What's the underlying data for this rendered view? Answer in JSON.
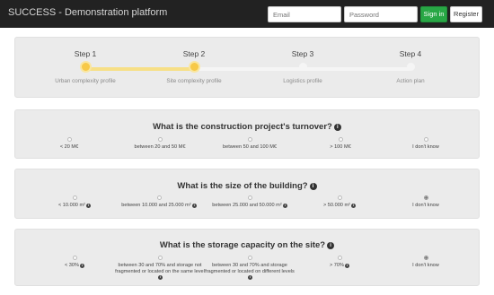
{
  "app": {
    "brand": "SUCCESS - Demonstration platform"
  },
  "nav": {
    "email_placeholder": "Email",
    "password_placeholder": "Password",
    "signin_label": "Sign in",
    "register_label": "Register"
  },
  "steps": [
    {
      "title": "Step 1",
      "subtitle": "Urban complexity profile",
      "state": "done"
    },
    {
      "title": "Step 2",
      "subtitle": "Site complexity profile",
      "state": "done"
    },
    {
      "title": "Step 3",
      "subtitle": "Logistics profile",
      "state": "todo"
    },
    {
      "title": "Step 4",
      "subtitle": "Action plan",
      "state": "todo"
    }
  ],
  "questions": [
    {
      "title": "What is the construction project's turnover?",
      "options": [
        {
          "label": "< 20 M€",
          "selected": false
        },
        {
          "label": "between 20 and 50 M€",
          "selected": false
        },
        {
          "label": "between 50 and 100 M€",
          "selected": false
        },
        {
          "label": "> 100 M€",
          "selected": false
        },
        {
          "label": "I don't know",
          "selected": false
        }
      ]
    },
    {
      "title": "What is the size of the building?",
      "options": [
        {
          "label": "< 10.000 m²",
          "selected": false
        },
        {
          "label": "between 10.000 and 25.000 m²",
          "selected": false
        },
        {
          "label": "between 25.000 and 50.000 m²",
          "selected": false
        },
        {
          "label": "> 50.000 m²",
          "selected": false
        },
        {
          "label": "I don't know",
          "selected": true
        }
      ]
    },
    {
      "title": "What is the storage capacity on the site?",
      "options": [
        {
          "label": "< 30%",
          "selected": false
        },
        {
          "label": "between 30 and 70% and storage not fragmented or located on the same level",
          "selected": false
        },
        {
          "label": "between 30 and 70% and storage fragmented or located on different levels",
          "selected": false
        },
        {
          "label": "> 70%",
          "selected": false
        },
        {
          "label": "I don't know",
          "selected": true
        }
      ]
    }
  ],
  "colors": {
    "navbar": "#222222",
    "signin": "#28a745",
    "step_active": "#f7c948",
    "panel": "#ebebeb"
  },
  "icons": {
    "info": "info-icon",
    "radio": "radio-button-icon"
  }
}
